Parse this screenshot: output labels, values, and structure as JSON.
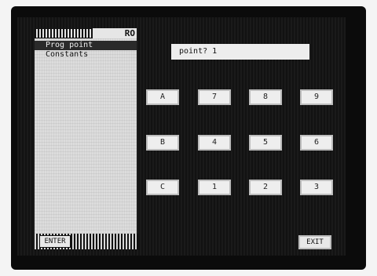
{
  "window": {
    "title": "RO"
  },
  "menu": {
    "items": [
      {
        "label": "Prog point",
        "selected": true
      },
      {
        "label": "Constants",
        "selected": false
      }
    ]
  },
  "prompt": {
    "label": "point?",
    "value": "1"
  },
  "keypad": {
    "row1": [
      "A",
      "7",
      "8",
      "9"
    ],
    "row2": [
      "B",
      "4",
      "5",
      "6"
    ],
    "row3": [
      "C",
      "1",
      "2",
      "3"
    ]
  },
  "softkeys": {
    "enter_label": "ENTER",
    "exit_label": "EXIT"
  },
  "colors": {
    "screen_bg": "#161616",
    "panel_bg": "#dcdcdc",
    "key_bg": "#eeeeee"
  }
}
